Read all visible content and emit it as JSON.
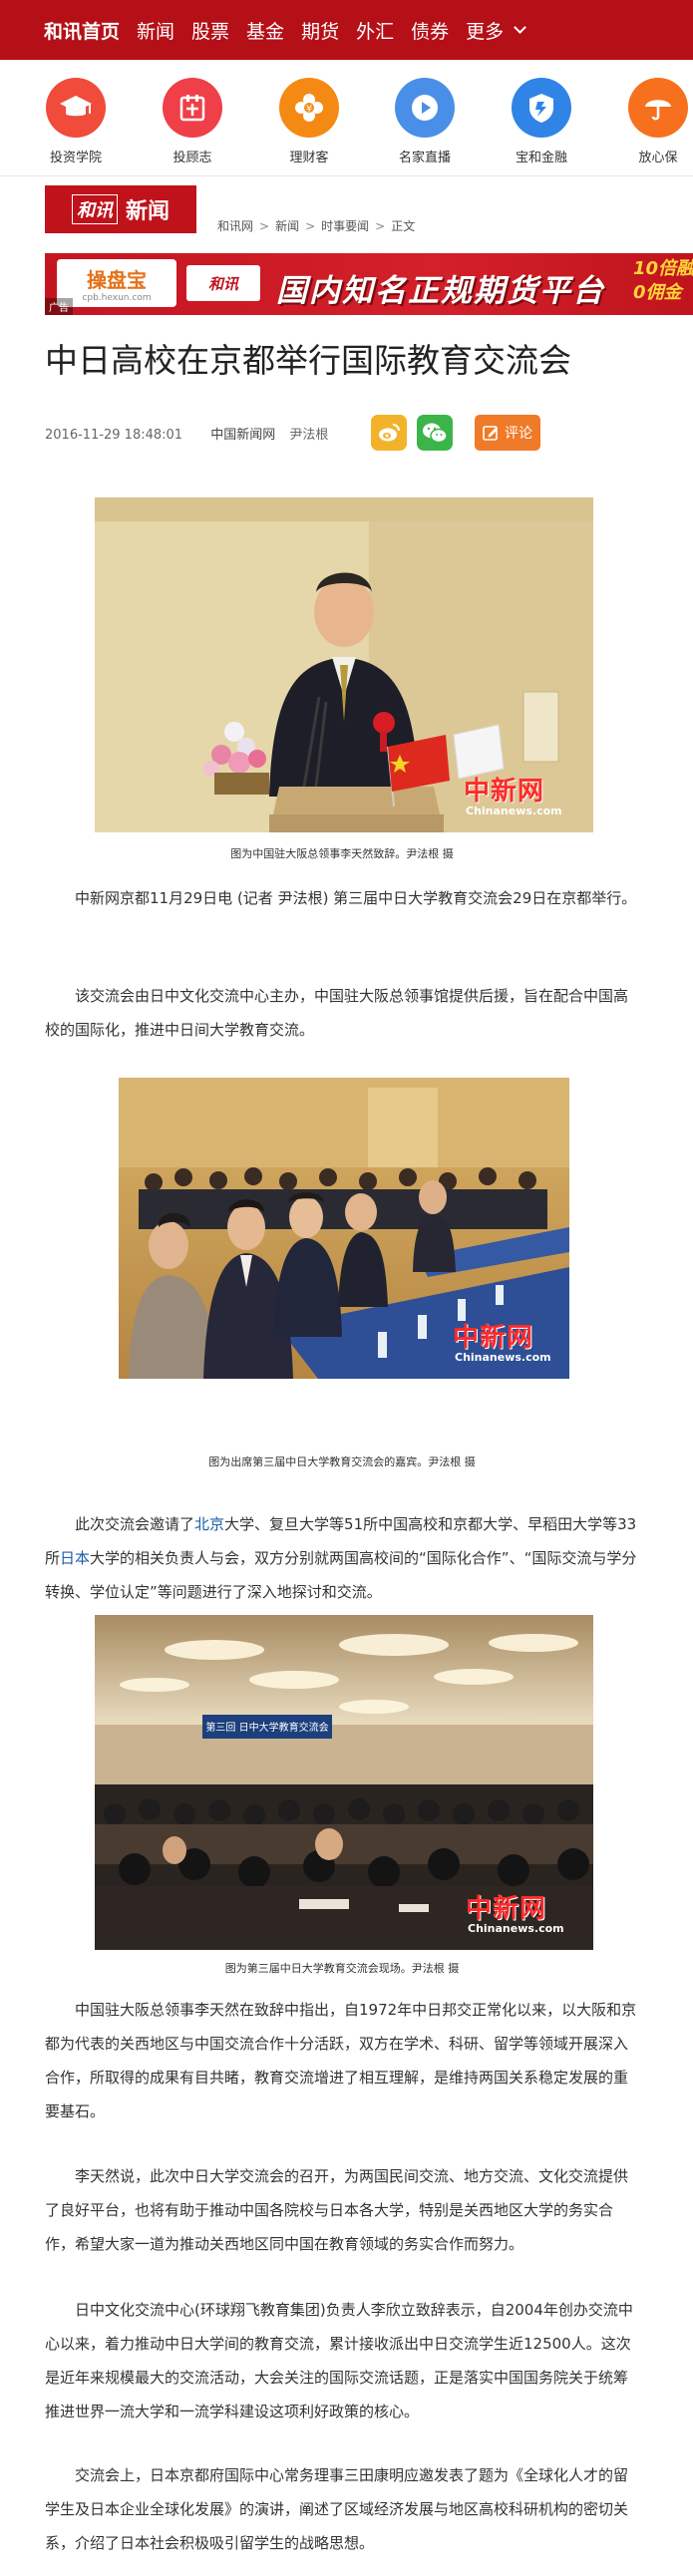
{
  "nav": {
    "items": [
      "和讯首页",
      "新闻",
      "股票",
      "基金",
      "期货",
      "外汇",
      "债券"
    ],
    "more": "更多"
  },
  "apps": [
    {
      "label": "投资学院",
      "icon": "graduation-cap-icon",
      "color": "#f04b3b"
    },
    {
      "label": "投顾志",
      "icon": "journal-icon",
      "color": "#ef3f48"
    },
    {
      "label": "理财客",
      "icon": "money-flower-icon",
      "color": "#f48a14"
    },
    {
      "label": "名家直播",
      "icon": "play-icon",
      "color": "#4a8fe7"
    },
    {
      "label": "宝和金融",
      "icon": "shield-icon",
      "color": "#2f84e6"
    },
    {
      "label": "放心保",
      "icon": "umbrella-icon",
      "color": "#f6701d"
    }
  ],
  "brand": {
    "mark": "和讯",
    "word": "新闻"
  },
  "breadcrumb": [
    "和讯网",
    "新闻",
    "时事要闻",
    "正文"
  ],
  "ad": {
    "brand1": "操盘宝",
    "brand1_sub": "cpb.hexun.com",
    "brand2": "和讯",
    "slogan": "国内知名正规期货平台",
    "promo1": "10倍融",
    "promo2": "0佣金",
    "tag": "广告"
  },
  "article": {
    "title": "中日高校在京都举行国际教育交流会",
    "datetime": "2016-11-29 18:48:01",
    "source": "中国新闻网",
    "author": "尹法根",
    "comment_label": "评论",
    "watermark": "中新网",
    "watermark_sub": "Chinanews.com",
    "caption1": "图为中国驻大阪总领事李天然致辞。尹法根 摄",
    "para1": "中新网京都11月29日电 (记者 尹法根) 第三届中日大学教育交流会29日在京都举行。",
    "para2": "该交流会由日中文化交流中心主办，中国驻大阪总领事馆提供后援，旨在配合中国高校的国际化，推进中日间大学教育交流。",
    "caption2": "图为出席第三届中日大学教育交流会的嘉宾。尹法根 摄",
    "para3_a": "此次交流会邀请了",
    "para3_link1": "北京",
    "para3_b": "大学、复旦大学等51所中国高校和京都大学、早稻田大学等33所",
    "para3_link2": "日本",
    "para3_c": "大学的相关负责人与会，双方分别就两国高校间的“国际化合作”、“国际交流与学分转换、学位认定”等问题进行了深入地探讨和交流。",
    "banner_text": "第三回 日中大学教育交流会",
    "caption3": "图为第三届中日大学教育交流会现场。尹法根 摄",
    "para4": "中国驻大阪总领事李天然在致辞中指出，自1972年中日邦交正常化以来，以大阪和京都为代表的关西地区与中国交流合作十分活跃，双方在学术、科研、留学等领域开展深入合作，所取得的成果有目共睹，教育交流增进了相互理解，是维持两国关系稳定发展的重要基石。",
    "para5": "李天然说，此次中日大学交流会的召开，为两国民间交流、地方交流、文化交流提供了良好平台，也将有助于推动中国各院校与日本各大学，特别是关西地区大学的务实合作，希望大家一道为推动关西地区同中国在教育领域的务实合作而努力。",
    "para6": "日中文化交流中心(环球翔飞教育集团)负责人李欣立致辞表示，自2004年创办交流中心以来，着力推动中日大学间的教育交流，累计接收派出中日交流学生近12500人。这次是近年来规模最大的交流活动，大会关注的国际交流话题，正是落实中国国务院关于统筹推进世界一流大学和一流学科建设这项利好政策的核心。",
    "para7": "交流会上，日本京都府国际中心常务理事三田康明应邀发表了题为《全球化人才的留学生及日本企业全球化发展》的演讲，阐述了区域经济发展与地区高校科研机构的密切关系，介绍了日本社会积极吸引留学生的战略思想。"
  }
}
